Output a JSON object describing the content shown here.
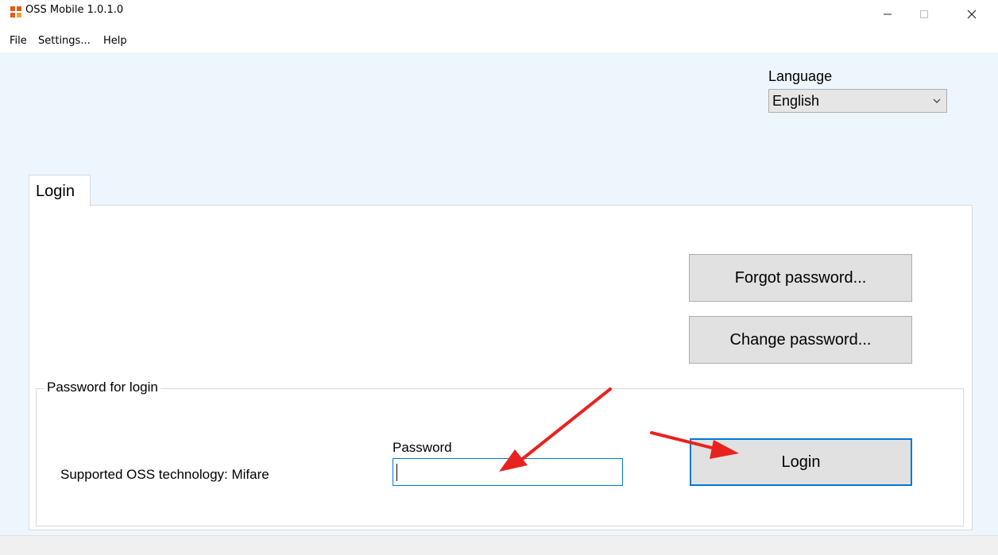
{
  "window": {
    "title": "OSS Mobile 1.0.1.0"
  },
  "menu": {
    "items": [
      "File",
      "Settings...",
      "Help"
    ]
  },
  "language": {
    "label": "Language",
    "selected": "English"
  },
  "tabs": [
    {
      "label": "Login",
      "active": true
    }
  ],
  "panel": {
    "forgot_password": "Forgot password...",
    "change_password": "Change password...",
    "group_title": "Password for login",
    "supported_tech": "Supported OSS technology: Mifare",
    "password_label": "Password",
    "password_value": "",
    "login_button": "Login"
  },
  "colors": {
    "client_bg": "#eef6fd",
    "accent_blue": "#0078d7",
    "button_gray": "#e1e1e1",
    "annotation_red": "#e8231f"
  },
  "icons": {
    "app": "oss-app-icon",
    "minimize": "minimize-icon",
    "maximize": "maximize-icon",
    "close": "close-icon",
    "dropdown": "chevron-down-icon"
  }
}
